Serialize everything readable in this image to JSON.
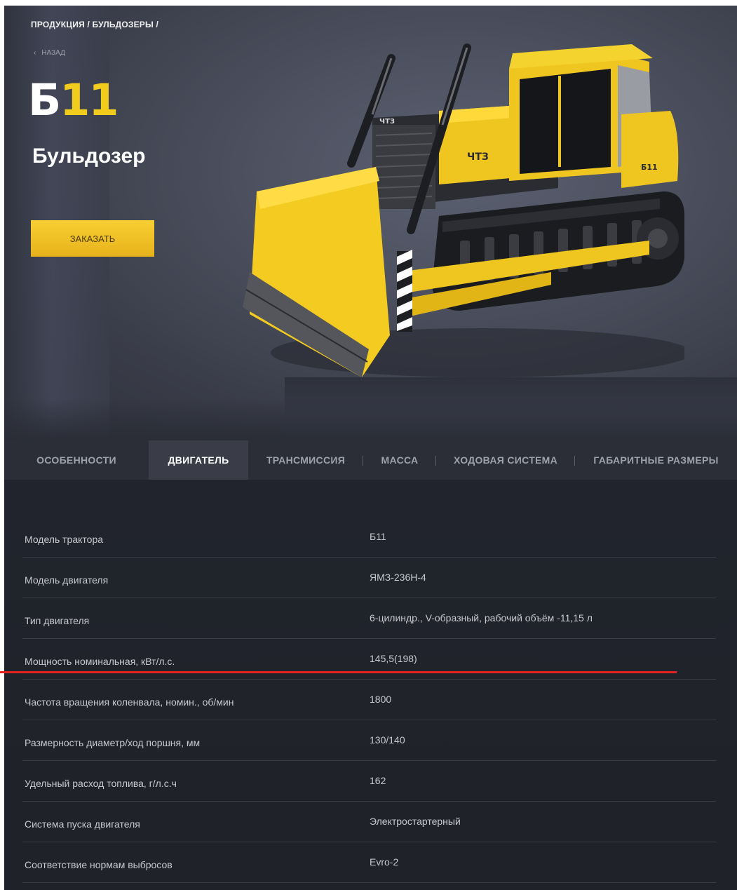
{
  "breadcrumb": "ПРОДУКЦИЯ / БУЛЬДОЗЕРЫ /",
  "back_label": "НАЗАД",
  "model_code": {
    "prefix": "Б",
    "suffix": "11"
  },
  "model_name": "Бульдозер",
  "order_button": "ЗАКАЗАТЬ",
  "dozer_labels": {
    "cab_brand": "ЧТЗ",
    "body_brand": "ЧТЗ",
    "model_badge": "Б11"
  },
  "tabs": [
    {
      "label": "ОСОБЕННОСТИ",
      "active": false
    },
    {
      "label": "ДВИГАТЕЛЬ",
      "active": true
    },
    {
      "label": "ТРАНСМИССИЯ",
      "active": false
    },
    {
      "label": "МАССА",
      "active": false
    },
    {
      "label": "ХОДОВАЯ СИСТЕМА",
      "active": false
    },
    {
      "label": "ГАБАРИТНЫЕ РАЗМЕРЫ",
      "active": false
    }
  ],
  "specs": [
    {
      "key": "Модель трактора",
      "value": "Б11"
    },
    {
      "key": "Модель двигателя",
      "value": "ЯМЗ-236Н-4"
    },
    {
      "key": "Тип двигателя",
      "value": "6-цилиндр., V-образный, рабочий объём -11,15 л"
    },
    {
      "key": "Мощность номинальная, кВт/л.с.",
      "value": "145,5(198)"
    },
    {
      "key": "Частота вращения коленвала, номин., об/мин",
      "value": "1800"
    },
    {
      "key": "Размерность диаметр/ход поршня, мм",
      "value": "130/140"
    },
    {
      "key": "Удельный расход топлива, г/л.с.ч",
      "value": "162"
    },
    {
      "key": "Система пуска двигателя",
      "value": "Электростартерный"
    },
    {
      "key": "Соответствие нормам выбросов",
      "value": "Evro-2"
    }
  ],
  "colors": {
    "accent": "#f2cc1d",
    "annotation_line": "#e32222"
  }
}
